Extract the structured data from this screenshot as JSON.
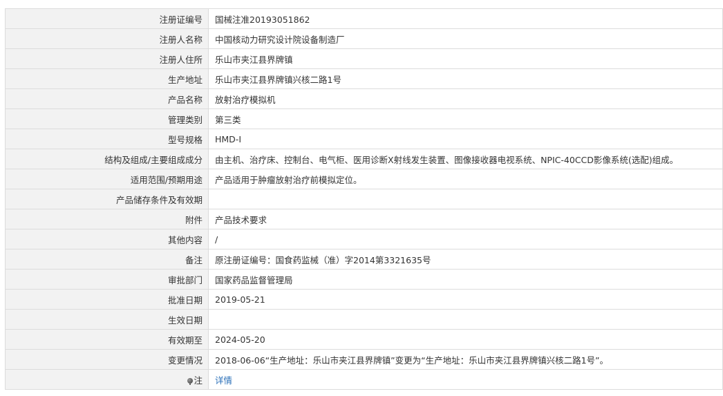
{
  "rows": [
    {
      "label": "注册证编号",
      "value": "国械注准20193051862"
    },
    {
      "label": "注册人名称",
      "value": "中国核动力研究设计院设备制造厂"
    },
    {
      "label": "注册人住所",
      "value": "乐山市夹江县界牌镇"
    },
    {
      "label": "生产地址",
      "value": "乐山市夹江县界牌镇兴核二路1号"
    },
    {
      "label": "产品名称",
      "value": "放射治疗模拟机"
    },
    {
      "label": "管理类别",
      "value": "第三类"
    },
    {
      "label": "型号规格",
      "value": "HMD-I"
    },
    {
      "label": "结构及组成/主要组成成分",
      "value": "由主机、治疗床、控制台、电气柜、医用诊断X射线发生装置、图像接收器电视系统、NPIC-40CCD影像系统(选配)组成。"
    },
    {
      "label": "适用范围/预期用途",
      "value": "产品适用于肿瘤放射治疗前模拟定位。"
    },
    {
      "label": "产品储存条件及有效期",
      "value": ""
    },
    {
      "label": "附件",
      "value": "产品技术要求"
    },
    {
      "label": "其他内容",
      "value": "/"
    },
    {
      "label": "备注",
      "value": "原注册证编号：国食药监械（准）字2014第3321635号"
    },
    {
      "label": "审批部门",
      "value": "国家药品监督管理局"
    },
    {
      "label": "批准日期",
      "value": "2019-05-21"
    },
    {
      "label": "生效日期",
      "value": ""
    },
    {
      "label": "有效期至",
      "value": "2024-05-20"
    },
    {
      "label": "变更情况",
      "value": "2018-06-06“生产地址：乐山市夹江县界牌镇”变更为“生产地址：乐山市夹江县界牌镇兴核二路1号”。"
    }
  ],
  "note": {
    "icon": "bulb-icon",
    "label": "注",
    "link_text": "详情",
    "link_color": "#2a6fb8"
  },
  "colors": {
    "label_background": "#f2f2f2",
    "border": "#dcdcdc"
  }
}
